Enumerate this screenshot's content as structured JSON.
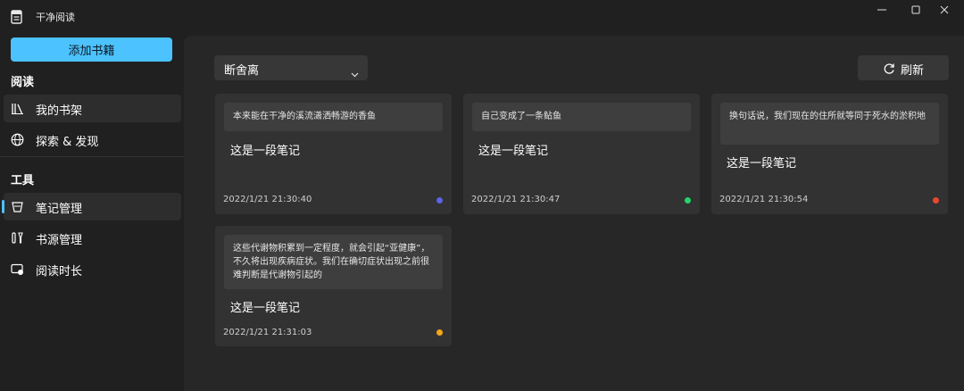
{
  "window": {
    "title": "干净阅读",
    "icon": "book-app-icon"
  },
  "sidebar": {
    "add_book_label": "添加书籍",
    "sections": [
      {
        "title": "阅读",
        "items": [
          {
            "label": "我的书架",
            "icon": "bookshelf-icon"
          },
          {
            "label": "探索 & 发现",
            "icon": "globe-icon"
          }
        ]
      },
      {
        "title": "工具",
        "items": [
          {
            "label": "笔记管理",
            "icon": "note-icon",
            "active": true
          },
          {
            "label": "书源管理",
            "icon": "source-icon"
          },
          {
            "label": "阅读时长",
            "icon": "timer-icon"
          }
        ]
      }
    ]
  },
  "toolbar": {
    "book_select": "断舍离",
    "refresh_label": "刷新"
  },
  "cards": [
    {
      "quote": "本来能在干净的溪流潇洒畅游的香鱼",
      "note": "这是一段笔记",
      "time": "2022/1/21 21:30:40",
      "color": "#5b63e6"
    },
    {
      "quote": "自己变成了一条鲇鱼",
      "note": "这是一段笔记",
      "time": "2022/1/21 21:30:47",
      "color": "#22d46a"
    },
    {
      "quote": "换句话说，我们现在的住所就等同于死水的淤积地",
      "note": "这是一段笔记",
      "time": "2022/1/21 21:30:54",
      "color": "#e8472f"
    },
    {
      "quote": "这些代谢物积累到一定程度，就会引起“亚健康”，不久将出现疾病症状。我们在确切症状出现之前很难判断是代谢物引起的",
      "note": "这是一段笔记",
      "time": "2022/1/21 21:31:03",
      "color": "#f4a616"
    }
  ],
  "colors": {
    "accent": "#4cc2ff",
    "background": "#202020",
    "panel": "#272727",
    "card": "#323232"
  }
}
